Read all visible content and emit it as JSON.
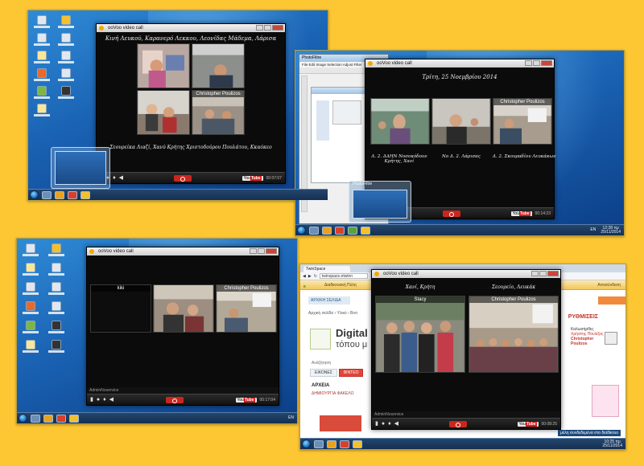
{
  "colors": {
    "background": "#fdc733",
    "oovoo_orange": "#f2a900",
    "end_call_red": "#c9271e"
  },
  "panels": [
    {
      "id": "top-left",
      "oovoo_title": "ooVoo video call",
      "caption_top": "Κινή Λευκού, Καρανερό Λεκκου, Λεονίδας Μάδεμα, Λάρισα",
      "caption_bottom": "Σεουρείκα Λιαζί, Χανύ Κρήτης   Χριστοδούρου Πουλάτου, Κκαόκεο",
      "tile_names": [
        "",
        "",
        "",
        "Christopher Poulizos"
      ],
      "timer": "00:07:07",
      "thumb_label": ""
    },
    {
      "id": "top-right",
      "photofiltre_title": "PhotoFiltre",
      "photofiltre_menu": "File  Edit  Image  Selection  Adjust  Filter",
      "oovoo_title": "ooVoo video call",
      "date_caption": "Τρίτη, 25 Νοεμβρίου 2014",
      "tile_names": [
        "",
        "",
        "Christopher Poulizos"
      ],
      "captions_bottom": [
        "Δ. 2. ΔΔΗΝ Νοσοκόδουν Κρήτης, Χανί",
        "Νο Δ. 2. Λάρισας",
        "Δ. 2. Σκουραδίου Λευκάκων"
      ],
      "timer": "00:14:23",
      "thumb_label": "PhotoFiltre",
      "clock": "12:28 πμ",
      "date": "25/11/2014",
      "lang": "EN"
    },
    {
      "id": "bottom-left",
      "oovoo_title": "ooVoo video call",
      "tile_names": [
        "kiki",
        "",
        "Christopher Poulizos"
      ],
      "status": "AdminNoservice",
      "timer": "00:17:04",
      "lang": "EN"
    },
    {
      "id": "bottom-right",
      "browser_tab": "TwinSpace",
      "browser_url": "twinspace.etwinn",
      "tw_header_left": "Διαδικτυακή Πύλη",
      "tw_header_right": "Αποσύνδεση",
      "tw_nav": "ΑΡΧΙΚΗ ΣΕΛΙΔΑ",
      "tw_crumb": "Αρχική σελίδα  ›  Υλικό  ›  Βιντ",
      "tw_title": "Digital",
      "tw_subtitle": "τόπου μ",
      "tw_label": "Ανάζήτηση",
      "tw_tabs": [
        "ΕΙΚΟΝΕΣ",
        "ΒΙΝΤΕΟ"
      ],
      "tw_section": "ΑΡΧΕΙΑ",
      "tw_folder": "ΔΗΜΙΟΥΡΓΙΑ ΦΑΚΕΛΟ",
      "tw_right_title": "ΡΥΘΜΙΣΕΙΣ",
      "tw_profile_lines": [
        "Καλωσήρθες",
        "Χρήστης Πουλίζος",
        "Christopher",
        "Poulizos"
      ],
      "oovoo_title": "ooVoo video call",
      "caption_left": "Χανί, Κρήτη",
      "caption_right": "Σεουρείο, Λευκάκ",
      "tile_names": [
        "Stacy",
        "Christopher Poulizos"
      ],
      "status": "AdminNoservice",
      "timer": "00:08:25",
      "notify": "μέλη συνδεδεμένα στο διαδίκτυο",
      "clock": "10:25 πμ",
      "date": "25/11/2014"
    }
  ]
}
